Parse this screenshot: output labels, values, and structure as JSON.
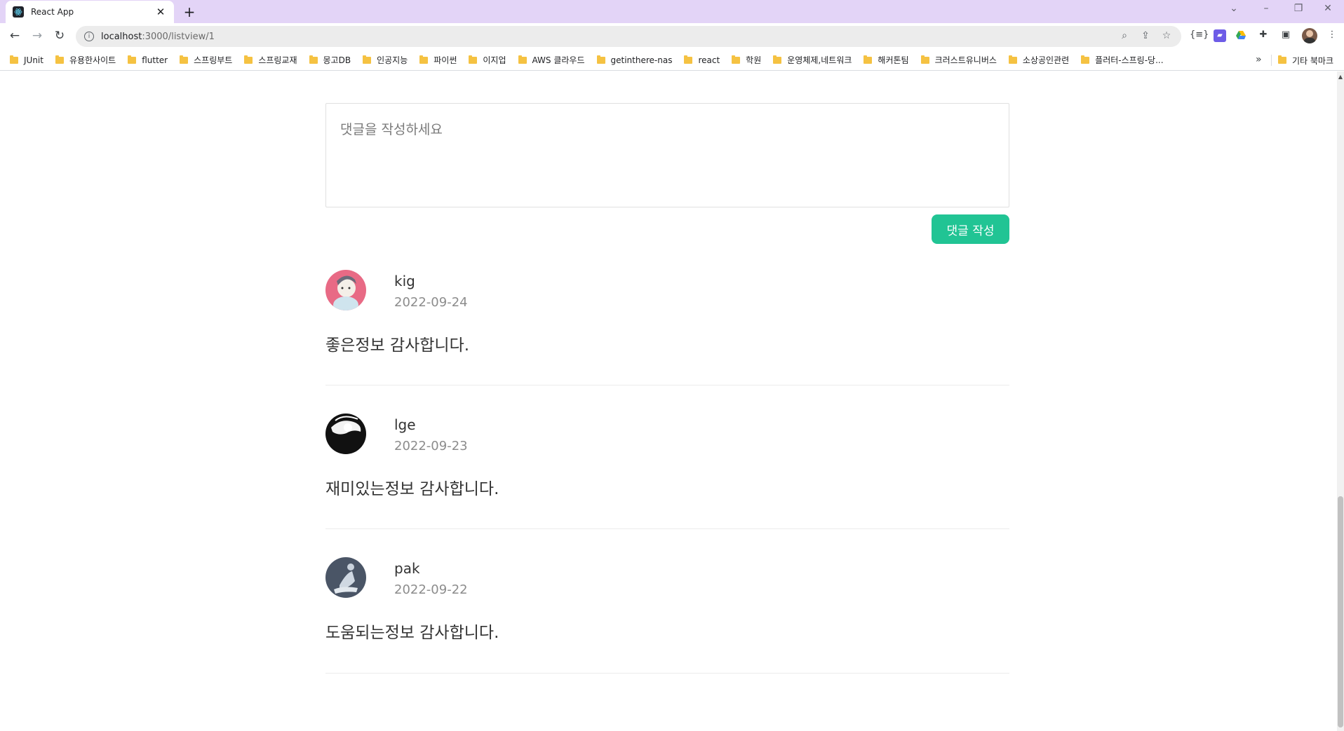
{
  "browser": {
    "tab_title": "React App",
    "new_tab_label": "+",
    "url_host": "localhost",
    "url_path": ":3000/listview/1"
  },
  "bookmarks": [
    {
      "label": "JUnit"
    },
    {
      "label": "유용한사이트"
    },
    {
      "label": "flutter"
    },
    {
      "label": "스프링부트"
    },
    {
      "label": "스프링교재"
    },
    {
      "label": "몽고DB"
    },
    {
      "label": "인공지능"
    },
    {
      "label": "파이썬"
    },
    {
      "label": "이지업"
    },
    {
      "label": "AWS 클라우드"
    },
    {
      "label": "getinthere-nas"
    },
    {
      "label": "react"
    },
    {
      "label": "학원"
    },
    {
      "label": "운영체제,네트워크"
    },
    {
      "label": "해커톤팀"
    },
    {
      "label": "크러스트유니버스"
    },
    {
      "label": "소상공인관련"
    },
    {
      "label": "플러터-스프링-당..."
    }
  ],
  "bookmarks_more": "»",
  "bookmarks_other": "기타 북마크",
  "comment_form": {
    "placeholder": "댓글을 작성하세요",
    "submit_label": "댓글 작성"
  },
  "comments": [
    {
      "author": "kig",
      "date": "2022-09-24",
      "text": "좋은정보 감사합니다.",
      "avatar_color": "#e86a85"
    },
    {
      "author": "lge",
      "date": "2022-09-23",
      "text": "재미있는정보 감사합니다.",
      "avatar_color": "#111111"
    },
    {
      "author": "pak",
      "date": "2022-09-22",
      "text": "도움되는정보 감사합니다.",
      "avatar_color": "#4a5566"
    }
  ],
  "colors": {
    "tabstrip": "#e3d4f7",
    "accent_button": "#21c494"
  }
}
